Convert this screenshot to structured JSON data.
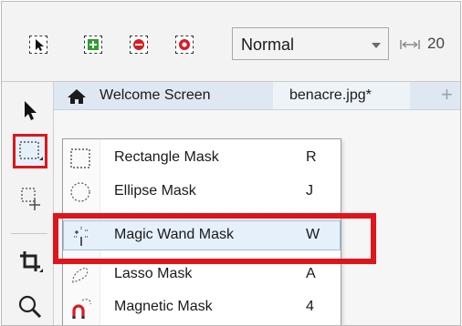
{
  "propbar": {
    "mode_buttons": [
      {
        "name": "normal-mode",
        "icon": "arrow-select-icon"
      },
      {
        "name": "add-mode",
        "icon": "plus-icon"
      },
      {
        "name": "subtract-mode",
        "icon": "minus-icon"
      },
      {
        "name": "xor-mode",
        "icon": "xor-icon"
      }
    ],
    "merge_mode": "Normal",
    "feather_value": "20"
  },
  "toolbox": {
    "tools": [
      {
        "name": "pick-tool",
        "icon": "pointer-icon"
      },
      {
        "name": "mask-tool",
        "icon": "rectangle-mask-icon",
        "active": true
      },
      {
        "name": "mask-transform-tool",
        "icon": "mask-transform-icon"
      },
      {
        "name": "crop-tool",
        "icon": "crop-icon"
      },
      {
        "name": "zoom-tool",
        "icon": "zoom-icon"
      }
    ]
  },
  "tabs": {
    "welcome": "Welcome Screen",
    "document": "benacre.jpg*",
    "add": "+"
  },
  "flyout": {
    "items": [
      {
        "label": "Rectangle Mask",
        "key": "R",
        "icon": "rectangle-mask-icon"
      },
      {
        "label": "Ellipse Mask",
        "key": "J",
        "icon": "ellipse-mask-icon"
      },
      {
        "label": "Magic Wand Mask",
        "key": "W",
        "icon": "magic-wand-icon",
        "selected": true
      },
      {
        "label": "Lasso Mask",
        "key": "A",
        "icon": "lasso-mask-icon"
      },
      {
        "label": "Magnetic Mask",
        "key": "4",
        "icon": "magnetic-mask-icon"
      }
    ]
  },
  "colors": {
    "highlight": "#e0151b",
    "selection": "#e6f0fb",
    "tab_bar": "#dfe8f2"
  }
}
